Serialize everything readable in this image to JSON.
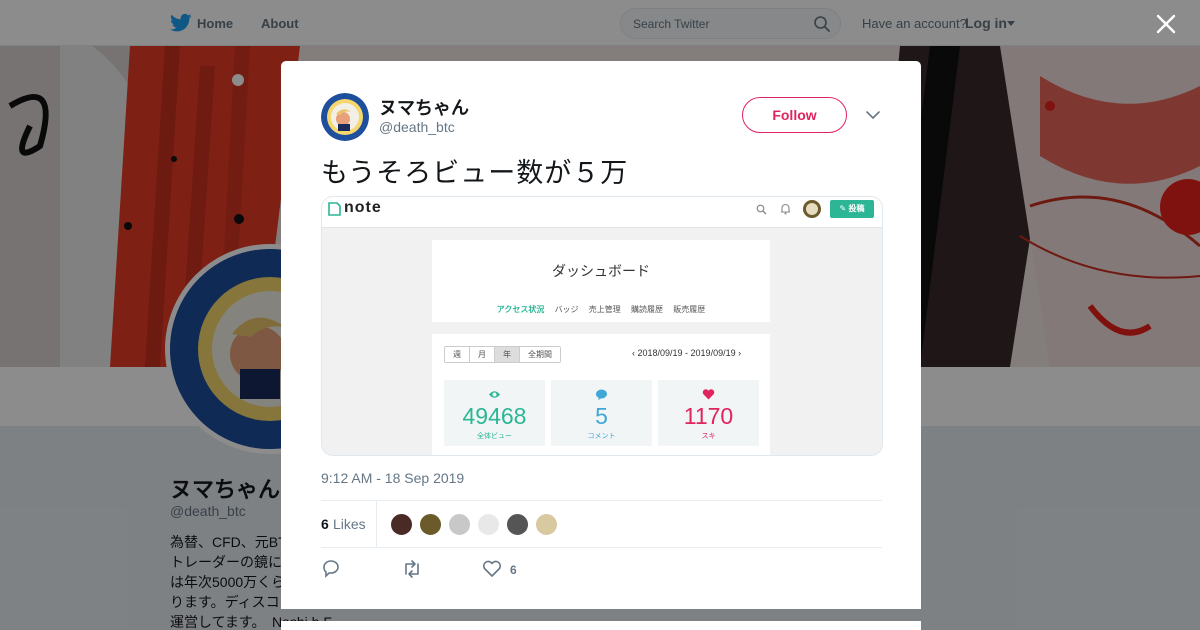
{
  "nav": {
    "home_label": "Home",
    "about_label": "About",
    "search_placeholder": "Search Twitter",
    "have_account": "Have an account?",
    "login_label": "Log in"
  },
  "profile": {
    "name": "ヌマちゃん",
    "handle": "@death_btc",
    "bio_lines": [
      "為替、CFD、元BT",
      "トレーダーの鏡に",
      "は年次5000万くら",
      "ります。ディスコ",
      "運営してます。"
    ],
    "bio_tail": "Nashi h F"
  },
  "tweet": {
    "author_name": "ヌマちゃん",
    "author_handle": "@death_btc",
    "follow_label": "Follow",
    "text": "もうそろビュー数が５万",
    "timestamp": "9:12 AM - 18 Sep 2019",
    "likes_count": "6",
    "likes_label": "Likes",
    "like_action_count": "6",
    "likers": [
      "#4a2a25",
      "#6b5a2a",
      "#c8c8c8",
      "#e8e8e8",
      "#555555",
      "#d9c9a0"
    ]
  },
  "media": {
    "logo_text": "note",
    "post_button": "投稿",
    "dashboard_title": "ダッシュボード",
    "tabs": [
      "アクセス状況",
      "バッジ",
      "売上管理",
      "購読履歴",
      "販売履歴"
    ],
    "periods": [
      "週",
      "月",
      "年",
      "全期間"
    ],
    "date_range": "2018/09/19 - 2019/09/19",
    "stats": [
      {
        "value": "49468",
        "label": "全体ビュー",
        "color": "#2cb696"
      },
      {
        "value": "5",
        "label": "コメント",
        "color": "#3fa8d8"
      },
      {
        "value": "1170",
        "label": "スキ",
        "color": "#e0245e"
      }
    ]
  },
  "colors": {
    "twitter_blue": "#1da1f2",
    "follow_red": "#e0245e",
    "note_green": "#2cb696"
  }
}
